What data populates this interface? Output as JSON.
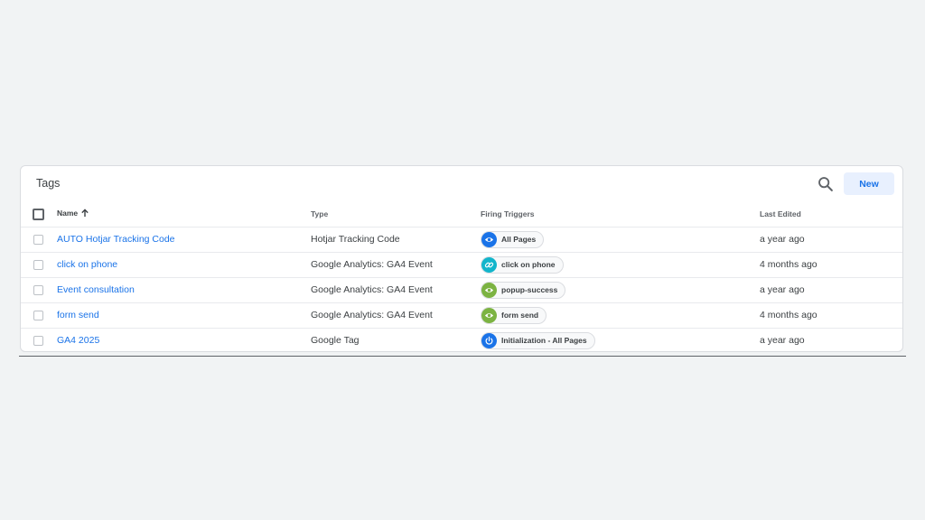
{
  "card": {
    "title": "Tags",
    "new_label": "New"
  },
  "columns": {
    "name": "Name",
    "type": "Type",
    "triggers": "Firing Triggers",
    "last_edited": "Last Edited"
  },
  "colors": {
    "link": "#1a73e8",
    "trigger_pageview": "#1a73e8",
    "trigger_click": "#12b5cb",
    "trigger_custom": "#7cb342",
    "trigger_init": "#1a73e8"
  },
  "rows": [
    {
      "name": "AUTO Hotjar Tracking Code",
      "type": "Hotjar Tracking Code",
      "trigger": "All Pages",
      "trigger_icon": "eye-icon",
      "last_edited": "a year ago"
    },
    {
      "name": "click on phone",
      "type": "Google Analytics: GA4 Event",
      "trigger": "click on phone",
      "trigger_icon": "link-icon",
      "last_edited": "4 months ago"
    },
    {
      "name": "Event consultation",
      "type": "Google Analytics: GA4 Event",
      "trigger": "popup-success",
      "trigger_icon": "eye-icon",
      "last_edited": "a year ago"
    },
    {
      "name": "form send",
      "type": "Google Analytics: GA4 Event",
      "trigger": "form send",
      "trigger_icon": "eye-icon",
      "last_edited": "4 months ago"
    },
    {
      "name": "GA4 2025",
      "type": "Google Tag",
      "trigger": "Initialization - All Pages",
      "trigger_icon": "power-icon",
      "last_edited": "a year ago"
    }
  ]
}
